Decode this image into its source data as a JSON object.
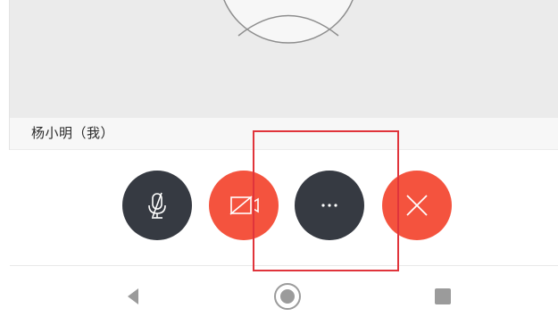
{
  "participant": {
    "name_label": "杨小明（我）"
  },
  "controls": [
    {
      "id": "mute",
      "icon": "mic-off-icon",
      "style": "dark"
    },
    {
      "id": "camera",
      "icon": "camera-off-icon",
      "style": "red"
    },
    {
      "id": "more",
      "icon": "more-icon",
      "style": "dark"
    },
    {
      "id": "hangup",
      "icon": "close-icon",
      "style": "red"
    }
  ],
  "navigation": {
    "back_icon": "back-icon",
    "home_icon": "home-icon",
    "recents_icon": "recents-icon"
  },
  "colors": {
    "accent_red": "#f4533e",
    "dark_button": "#363a42",
    "highlight_outline": "#e0343b"
  }
}
